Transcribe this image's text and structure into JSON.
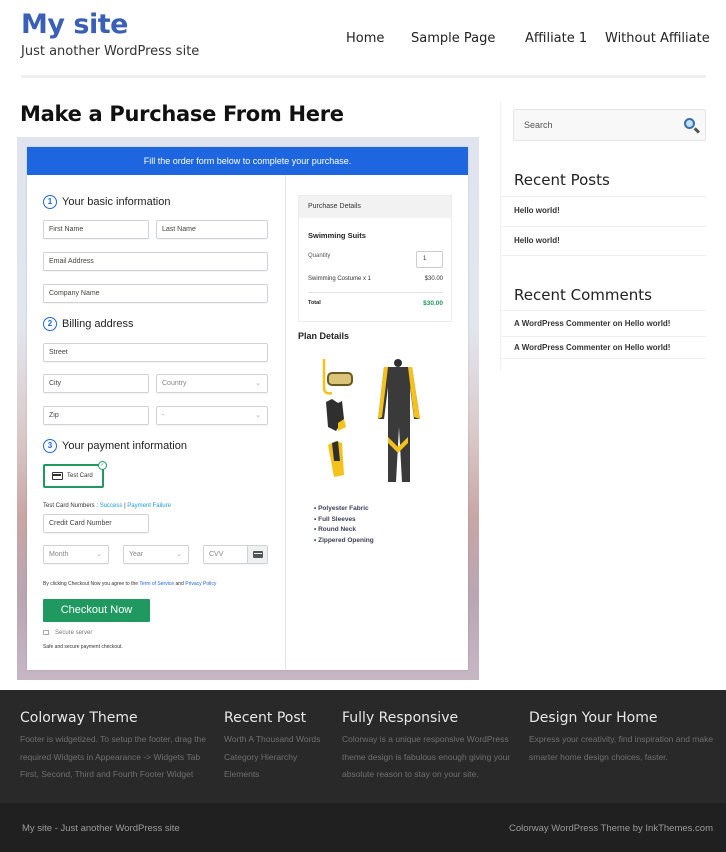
{
  "site": {
    "title": "My site",
    "tagline": "Just another WordPress site"
  },
  "nav": {
    "items": [
      {
        "label": "Home"
      },
      {
        "label": "Sample Page"
      },
      {
        "label": "Affiliate 1"
      },
      {
        "label": "Without Affiliate"
      }
    ]
  },
  "page": {
    "title": "Make a Purchase From Here"
  },
  "form": {
    "banner": "Fill the order form below to complete your purchase.",
    "accent_color": "#1e66e0",
    "sections": [
      {
        "number": "1",
        "label": "Your basic information"
      },
      {
        "number": "2",
        "label": "Billing address"
      },
      {
        "number": "3",
        "label": "Your payment information"
      }
    ],
    "fields": {
      "first_name": "First Name",
      "last_name": "Last Name",
      "email": "Email Address",
      "company": "Company Name",
      "street": "Street",
      "city": "City",
      "country": "Country",
      "zip": "Zip",
      "state": "-",
      "credit_card": "Credit Card Number",
      "month": "Month",
      "year": "Year",
      "cvv": "CVV"
    },
    "payment_method": "Test Card",
    "test_card_numbers_label": "Test Card Numbers :",
    "test_success_link": "Success",
    "test_separator": "|",
    "test_failure_link": "Payment Failure",
    "agree_text": "By clicking Checkout Now you agree to the",
    "terms_link": "Term of Service",
    "and_text": "and",
    "privacy_link": "Privacy Policy",
    "checkout_button": "Checkout Now",
    "checkout_color": "#1f9960",
    "secure_server": "Secure server",
    "safe_text": "Safe and secure payment checkout."
  },
  "purchase_details": {
    "header": "Purchase Details",
    "product": "Swimming Suits",
    "quantity_label": "Quantity",
    "quantity": "1",
    "line_item": "Swimming Costume x 1",
    "line_amount": "$30.00",
    "total_label": "Total",
    "total_amount": "$30.00"
  },
  "plan": {
    "title": "Plan Details",
    "image_alt": "swimming gear: snorkel mask, gloves, fins, wetsuit",
    "features": [
      "Polyester Fabric",
      "Full Sleeves",
      "Round Neck",
      "Zippered Opening"
    ]
  },
  "sidebar": {
    "search_placeholder": "Search",
    "recent_posts_title": "Recent Posts",
    "recent_posts": [
      "Hello world!",
      "Hello world!"
    ],
    "recent_comments_title": "Recent Comments",
    "recent_comments": [
      "A WordPress Commenter on Hello world!",
      "A WordPress Commenter on Hello world!"
    ]
  },
  "footer": {
    "columns": [
      {
        "title": "Colorway Theme",
        "text": "Footer is widgetized. To setup the footer, drag the required Widgets in Appearance -> Widgets Tab First, Second, Third and Fourth Footer Widget"
      },
      {
        "title": "Recent Post",
        "links": [
          "Worth A Thousand Words",
          "Category Hierarchy",
          "Elements"
        ]
      },
      {
        "title": "Fully Responsive",
        "text": "Colorway is a unique responsive WordPress theme design is fabulous enough giving your absolute reason to stay on your site."
      },
      {
        "title": "Design Your Home",
        "text": "Express your creativity, find inspiration and make smarter home design choices, faster."
      }
    ],
    "bottom_left": "My site - Just another WordPress site",
    "bottom_right": "Colorway WordPress Theme by InkThemes.com"
  }
}
